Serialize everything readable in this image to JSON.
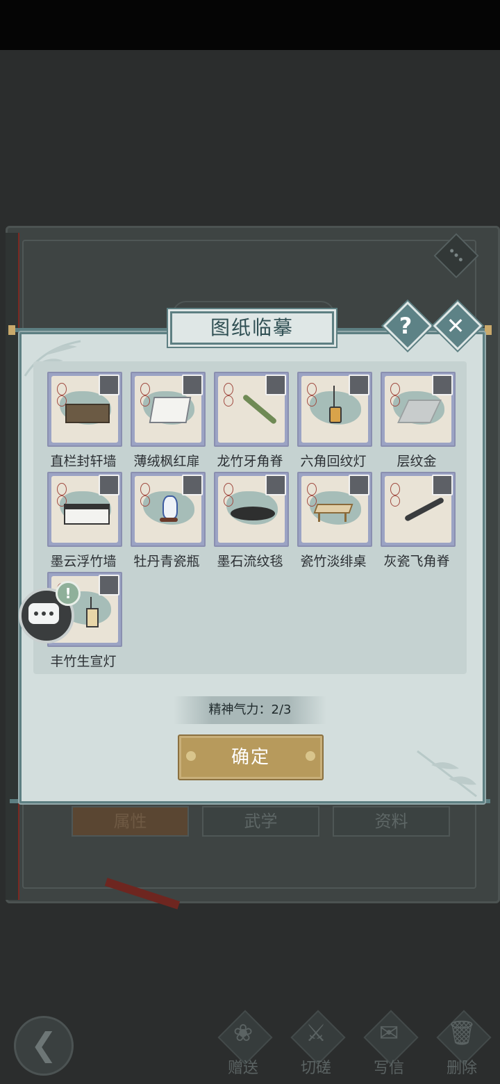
{
  "dialog": {
    "title": "图纸临摹",
    "help_glyph": "?",
    "close_glyph": "✕"
  },
  "items": [
    {
      "name": "直栏封轩墙",
      "icon": "wall-icon"
    },
    {
      "name": "薄绒枫红扉",
      "icon": "screen-icon"
    },
    {
      "name": "龙竹牙角脊",
      "icon": "ridge-icon"
    },
    {
      "name": "六角回纹灯",
      "icon": "lantern-icon"
    },
    {
      "name": "层纹金",
      "icon": "floor-tile-icon"
    },
    {
      "name": "墨云浮竹墙",
      "icon": "wall-icon"
    },
    {
      "name": "牡丹青瓷瓶",
      "icon": "vase-icon"
    },
    {
      "name": "墨石流纹毯",
      "icon": "rug-icon"
    },
    {
      "name": "瓷竹淡绯桌",
      "icon": "table-icon"
    },
    {
      "name": "灰瓷飞角脊",
      "icon": "ridge-icon"
    },
    {
      "name": "丰竹生宣灯",
      "icon": "lantern-icon"
    }
  ],
  "stamina": {
    "text": "精神气力：2/3",
    "current": 2,
    "max": 3
  },
  "confirm_label": "确定",
  "background": {
    "tabs": [
      "属性",
      "武学",
      "资料"
    ]
  },
  "chat": {
    "alert": "!"
  },
  "bottom_bar": {
    "back_glyph": "❮",
    "actions": [
      {
        "label": "赠送",
        "icon": "gift-icon"
      },
      {
        "label": "切磋",
        "icon": "sword-icon"
      },
      {
        "label": "写信",
        "icon": "letter-icon"
      },
      {
        "label": "删除",
        "icon": "trash-icon"
      }
    ]
  },
  "colors": {
    "dialog_bg": "#d3dedd",
    "dialog_border": "#5d7f82",
    "confirm_bg": "#b79a5c",
    "item_frame": "#9ba3c4"
  }
}
